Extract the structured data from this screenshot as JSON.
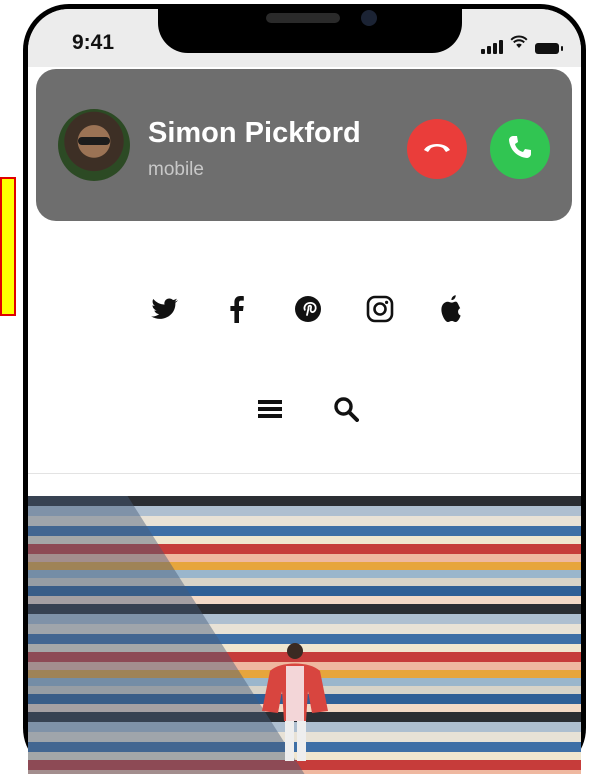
{
  "status_bar": {
    "time": "9:41"
  },
  "call": {
    "caller_name": "Simon Pickford",
    "caller_label": "mobile",
    "decline_icon": "phone-hangup-icon",
    "accept_icon": "phone-icon",
    "decline_color": "#ea3d3a",
    "accept_color": "#31c552"
  },
  "social_icons": [
    "twitter-icon",
    "facebook-icon",
    "pinterest-icon",
    "instagram-icon",
    "apple-icon"
  ],
  "toolbar_icons": [
    "menu-icon",
    "search-icon"
  ]
}
